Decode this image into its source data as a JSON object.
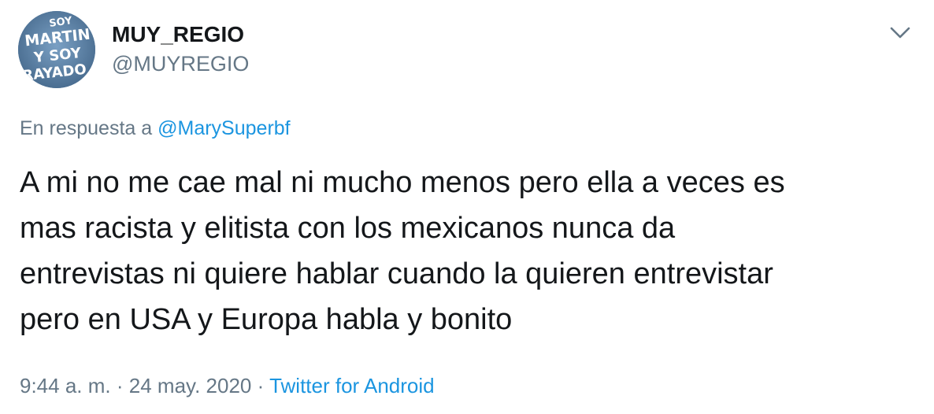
{
  "user": {
    "display_name": "MUY_REGIO",
    "handle": "@MUYREGIO",
    "avatar_text": [
      "SOY",
      "MARTIN",
      "Y SOY",
      "RAYADO"
    ]
  },
  "menu": {
    "icon": "chevron-down-icon"
  },
  "reply": {
    "prefix": "En respuesta a",
    "mention": "@MarySuperbf"
  },
  "tweet": {
    "lines": [
      "A mi no me cae mal ni mucho menos pero ella a veces es",
      "mas racista y elitista con los mexicanos nunca da",
      "entrevistas ni quiere hablar cuando la quieren entrevistar",
      "pero en USA y Europa habla y bonito"
    ]
  },
  "meta": {
    "time": "9:44 a. m.",
    "separator1": "·",
    "date": "24 may. 2020",
    "separator2": "·",
    "source": "Twitter for Android"
  },
  "colors": {
    "text": "#14171a",
    "secondary": "#657786",
    "link": "#1b95e0",
    "avatar_bg": "#5d83a8"
  }
}
